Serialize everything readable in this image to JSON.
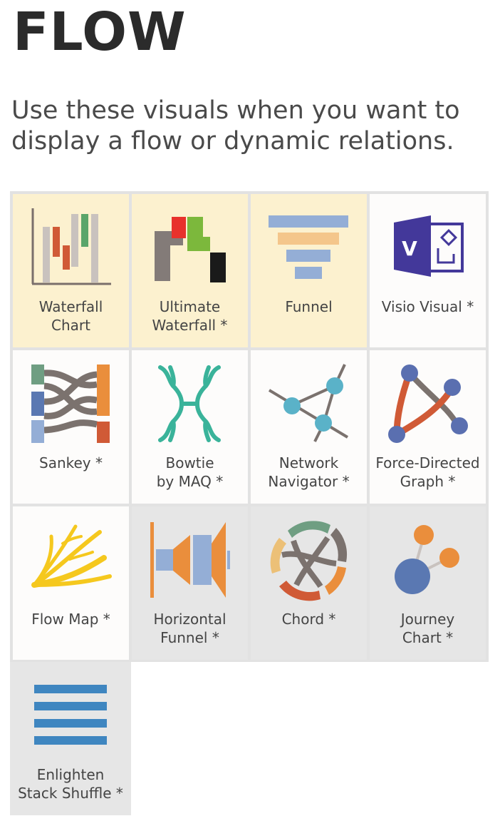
{
  "title": "FLOW",
  "subtitle": "Use these visuals when you want to display a flow or dynamic relations.",
  "tiles": [
    {
      "label": "Waterfall\nChart",
      "icon": "waterfall-chart-icon"
    },
    {
      "label": "Ultimate\nWaterfall *",
      "icon": "ultimate-waterfall-icon"
    },
    {
      "label": "Funnel",
      "icon": "funnel-icon"
    },
    {
      "label": "Visio Visual *",
      "icon": "visio-icon"
    },
    {
      "label": "Sankey *",
      "icon": "sankey-icon"
    },
    {
      "label": "Bowtie\nby MAQ *",
      "icon": "bowtie-icon"
    },
    {
      "label": "Network\nNavigator *",
      "icon": "network-navigator-icon"
    },
    {
      "label": "Force-Directed\nGraph *",
      "icon": "force-directed-graph-icon"
    },
    {
      "label": "Flow Map *",
      "icon": "flow-map-icon"
    },
    {
      "label": "Horizontal\nFunnel *",
      "icon": "horizontal-funnel-icon"
    },
    {
      "label": "Chord *",
      "icon": "chord-icon"
    },
    {
      "label": "Journey\nChart *",
      "icon": "journey-chart-icon"
    },
    {
      "label": "Enlighten\nStack Shuffle *",
      "icon": "stack-shuffle-icon"
    }
  ],
  "colors": {
    "highlight_tile": "#fcf1cf",
    "default_tile": "#fdfcfb",
    "grey_tile": "#e6e6e6"
  }
}
